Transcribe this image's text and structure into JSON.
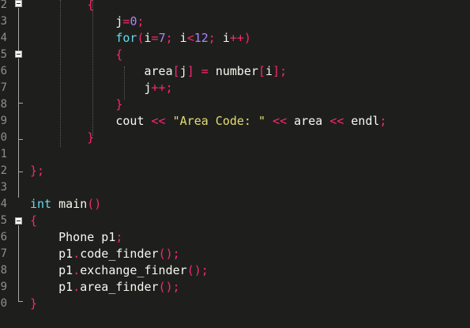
{
  "editor": {
    "colors": {
      "background": "#1e1f1c",
      "text": "#f8f8f2",
      "keyword": "#66d9ef",
      "operator": "#f92672",
      "number": "#ae81ff",
      "string": "#e6db74",
      "gutter_text": "#8f908a"
    },
    "gutter": {
      "line_numbers": [
        "2",
        "3",
        "4",
        "5",
        "6",
        "7",
        "8",
        "9",
        "0",
        "1",
        "2",
        "3",
        "4",
        "5",
        "6",
        "7",
        "8",
        "9",
        "0"
      ]
    },
    "lines": [
      [
        {
          "t": "        ",
          "c": "pl"
        },
        {
          "t": "{",
          "c": "pn"
        }
      ],
      [
        {
          "t": "            j",
          "c": "pl"
        },
        {
          "t": "=",
          "c": "op"
        },
        {
          "t": "0",
          "c": "num"
        },
        {
          "t": ";",
          "c": "op"
        }
      ],
      [
        {
          "t": "            ",
          "c": "pl"
        },
        {
          "t": "for",
          "c": "kw"
        },
        {
          "t": "(",
          "c": "pn"
        },
        {
          "t": "i",
          "c": "pl"
        },
        {
          "t": "=",
          "c": "op"
        },
        {
          "t": "7",
          "c": "num"
        },
        {
          "t": "; ",
          "c": "op"
        },
        {
          "t": "i",
          "c": "pl"
        },
        {
          "t": "<",
          "c": "op"
        },
        {
          "t": "12",
          "c": "num"
        },
        {
          "t": "; ",
          "c": "op"
        },
        {
          "t": "i",
          "c": "pl"
        },
        {
          "t": "++)",
          "c": "op"
        }
      ],
      [
        {
          "t": "            ",
          "c": "pl"
        },
        {
          "t": "{",
          "c": "pn"
        }
      ],
      [
        {
          "t": "                area",
          "c": "pl"
        },
        {
          "t": "[",
          "c": "pn"
        },
        {
          "t": "j",
          "c": "pl"
        },
        {
          "t": "]",
          "c": "pn"
        },
        {
          "t": " = ",
          "c": "op"
        },
        {
          "t": "number",
          "c": "pl"
        },
        {
          "t": "[",
          "c": "pn"
        },
        {
          "t": "i",
          "c": "pl"
        },
        {
          "t": "];",
          "c": "pn"
        }
      ],
      [
        {
          "t": "                j",
          "c": "pl"
        },
        {
          "t": "++;",
          "c": "op"
        }
      ],
      [
        {
          "t": "            ",
          "c": "pl"
        },
        {
          "t": "}",
          "c": "pn"
        }
      ],
      [
        {
          "t": "            cout ",
          "c": "pl"
        },
        {
          "t": "<<",
          "c": "op"
        },
        {
          "t": " ",
          "c": "pl"
        },
        {
          "t": "\"Area Code: \"",
          "c": "str"
        },
        {
          "t": " ",
          "c": "pl"
        },
        {
          "t": "<<",
          "c": "op"
        },
        {
          "t": " area ",
          "c": "pl"
        },
        {
          "t": "<<",
          "c": "op"
        },
        {
          "t": " endl",
          "c": "pl"
        },
        {
          "t": ";",
          "c": "op"
        }
      ],
      [
        {
          "t": "        ",
          "c": "pl"
        },
        {
          "t": "}",
          "c": "pn"
        }
      ],
      [],
      [
        {
          "t": "}",
          "c": "pn"
        },
        {
          "t": ";",
          "c": "op"
        }
      ],
      [],
      [
        {
          "t": "int",
          "c": "kw"
        },
        {
          "t": " main",
          "c": "pl"
        },
        {
          "t": "()",
          "c": "pn"
        }
      ],
      [
        {
          "t": "{",
          "c": "pn"
        }
      ],
      [
        {
          "t": "    Phone p1",
          "c": "pl"
        },
        {
          "t": ";",
          "c": "op"
        }
      ],
      [
        {
          "t": "    p1",
          "c": "pl"
        },
        {
          "t": ".",
          "c": "op"
        },
        {
          "t": "code_finder",
          "c": "pl"
        },
        {
          "t": "();",
          "c": "pn"
        }
      ],
      [
        {
          "t": "    p1",
          "c": "pl"
        },
        {
          "t": ".",
          "c": "op"
        },
        {
          "t": "exchange_finder",
          "c": "pl"
        },
        {
          "t": "();",
          "c": "pn"
        }
      ],
      [
        {
          "t": "    p1",
          "c": "pl"
        },
        {
          "t": ".",
          "c": "op"
        },
        {
          "t": "area_finder",
          "c": "pl"
        },
        {
          "t": "();",
          "c": "pn"
        }
      ],
      [
        {
          "t": "}",
          "c": "pn"
        }
      ]
    ]
  }
}
